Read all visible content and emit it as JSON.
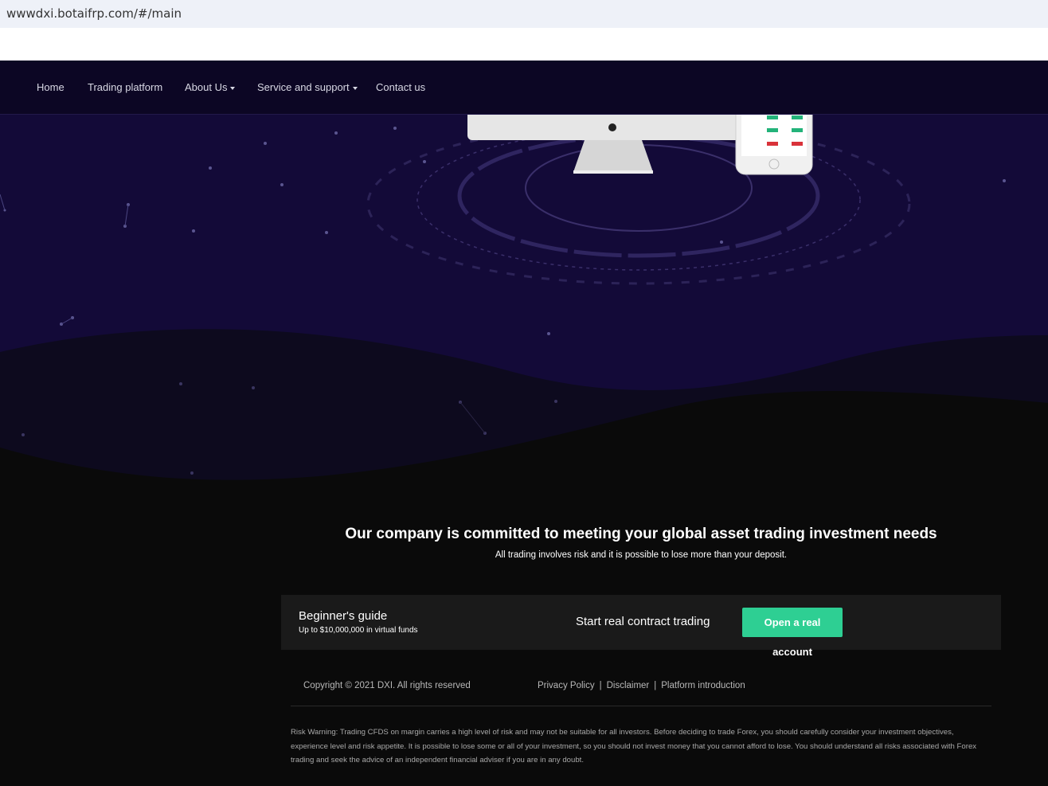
{
  "browser": {
    "url": "wwwdxi.botaifrp.com/#/main"
  },
  "nav": {
    "home": "Home",
    "trading_platform": "Trading platform",
    "about_us": "About Us",
    "service_support": "Service and support",
    "contact_us": "Contact us"
  },
  "hero": {
    "headline": "Our company is committed to meeting your global asset trading investment needs",
    "subline": "All trading involves risk and it is possible to lose more than your deposit."
  },
  "guide": {
    "title": "Beginner's guide",
    "subtitle": "Up to $10,000,000 in virtual funds",
    "start_text": "Start real contract trading",
    "button_line1": "Open a real",
    "button_line2": "account"
  },
  "footer": {
    "copyright": "Copyright © 2021 DXI. All rights reserved",
    "privacy": "Privacy Policy",
    "disclaimer": "Disclaimer",
    "platform_intro": "Platform introduction",
    "separator": "|",
    "risk_warning": "Risk Warning: Trading CFDS on margin carries a high level of risk and may not be suitable for all investors. Before deciding to trade Forex, you should carefully consider your investment objectives, experience level and risk appetite. It is possible to lose some or all of your investment, so you should not invest money that you cannot afford to lose. You should understand all risks associated with Forex trading and seek the advice of an independent financial adviser if you are in any doubt."
  },
  "colors": {
    "hero_bg": "#130a38",
    "nav_bg": "#0c0624",
    "page_bg": "#0a0a0a",
    "accent": "#2ecf93"
  }
}
